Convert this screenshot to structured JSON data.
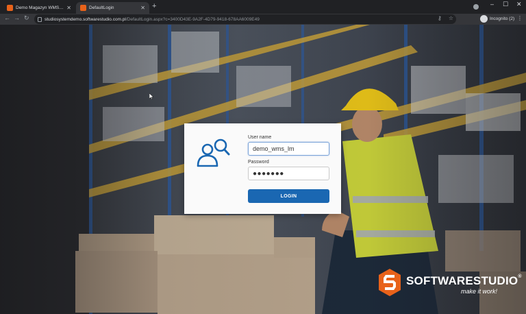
{
  "browser": {
    "tabs": [
      {
        "title": "Demo Magazyn WMS - Demo o",
        "active": false
      },
      {
        "title": "DefaultLogin",
        "active": true
      }
    ],
    "new_tab": "+",
    "close_glyph": "✕",
    "url_host": "studiosystemdemo.softwarestudio.com.pl",
    "url_path": "/DefaultLogin.aspx?c=3400D43E-9A2F-4D79-9418-678AA6009E49",
    "incognito_label": "Incognito (2)",
    "window_controls": {
      "minimize": "–",
      "maximize": "☐",
      "close": "✕"
    },
    "nav": {
      "back": "←",
      "forward": "→",
      "reload": "↻"
    },
    "omni_icons": {
      "key": "⚷",
      "star": "☆"
    },
    "menu": "⋮"
  },
  "login": {
    "username_label": "User name",
    "username_value": "demo_wms_lm",
    "password_label": "Password",
    "password_value": "●●●●●●●",
    "login_button": "LOGIN",
    "icon": "user-search-icon"
  },
  "logo": {
    "brand": "SOFTWARESTUDIO",
    "registered": "®",
    "tagline": "make it work!",
    "mark_icon": "s-logo-icon"
  },
  "colors": {
    "login_button": "#1a67b2",
    "user_icon": "#1a67b2",
    "logo_orange": "#e8621a",
    "focused_field_border": "#7aa3d8"
  }
}
